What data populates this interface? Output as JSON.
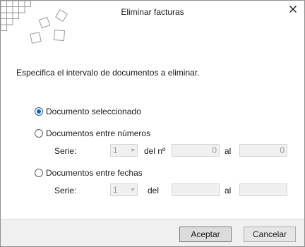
{
  "dialog": {
    "title": "Eliminar facturas",
    "instruction": "Especifica el intervalo de documentos a eliminar."
  },
  "options": {
    "selected": {
      "label": "Documento seleccionado",
      "checked": true
    },
    "by_number": {
      "label": "Documentos entre números",
      "checked": false,
      "serie_label": "Serie:",
      "serie_value": "1",
      "from_label": "del nº",
      "from_value": "0",
      "to_label": "al",
      "to_value": "0"
    },
    "by_date": {
      "label": "Documentos entre fechas",
      "checked": false,
      "serie_label": "Serie:",
      "serie_value": "1",
      "from_label": "del",
      "from_value": "",
      "to_label": "al",
      "to_value": ""
    }
  },
  "buttons": {
    "accept": "Aceptar",
    "cancel": "Cancelar"
  },
  "icons": {
    "close": "close-icon",
    "decoration": "tiles-decoration"
  },
  "colors": {
    "accent": "#0d61b4",
    "footer": "#f0f0f0"
  }
}
